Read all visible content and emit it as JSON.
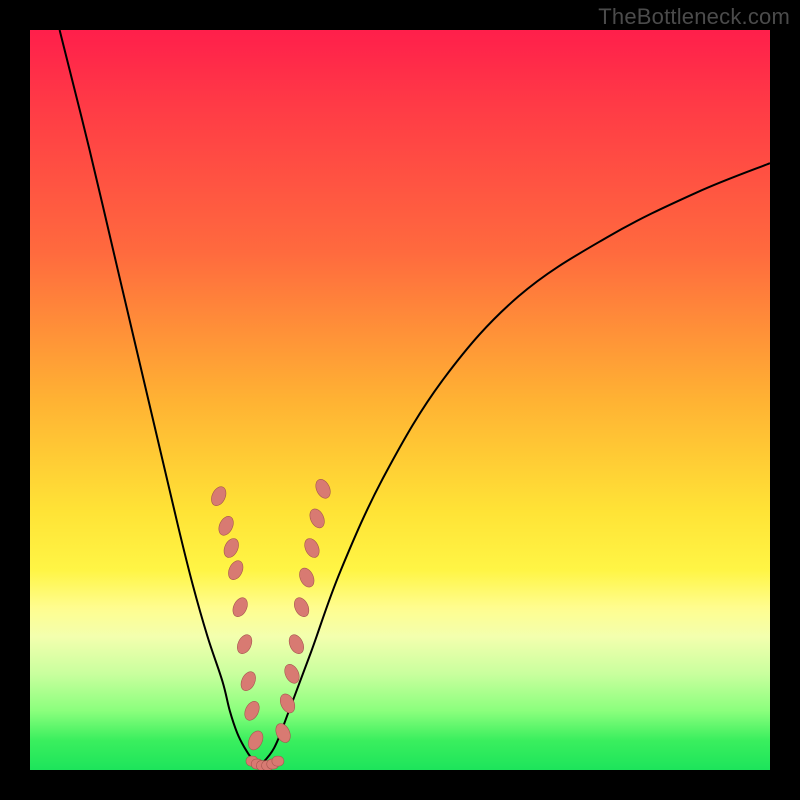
{
  "watermark": "TheBottleneck.com",
  "colors": {
    "frame": "#000000",
    "curve": "#000000",
    "marker_fill": "#d87a72",
    "marker_stroke": "#a5554e",
    "gradient_top": "#ff1f4b",
    "gradient_bottom": "#1de45b"
  },
  "chart_data": {
    "type": "line",
    "title": "",
    "xlabel": "",
    "ylabel": "",
    "xlim": [
      0,
      100
    ],
    "ylim": [
      0,
      100
    ],
    "series": [
      {
        "name": "left-curve",
        "x": [
          4,
          8,
          12,
          16,
          20,
          22,
          24,
          26,
          27,
          28,
          29,
          30,
          31
        ],
        "y": [
          100,
          84,
          67,
          50,
          33,
          25,
          18,
          12,
          8,
          5,
          3,
          1.5,
          0.5
        ]
      },
      {
        "name": "right-curve",
        "x": [
          31,
          33,
          35,
          38,
          42,
          48,
          56,
          66,
          78,
          90,
          100
        ],
        "y": [
          0.5,
          3,
          8,
          16,
          27,
          40,
          53,
          64,
          72,
          78,
          82
        ]
      },
      {
        "name": "markers-left",
        "x": [
          25.5,
          26.5,
          27.2,
          27.8,
          28.4,
          29.0,
          29.5,
          30.0,
          30.5
        ],
        "y": [
          37,
          33,
          30,
          27,
          22,
          17,
          12,
          8,
          4
        ]
      },
      {
        "name": "markers-bottom",
        "x": [
          30.0,
          30.7,
          31.4,
          32.1,
          32.8,
          33.5
        ],
        "y": [
          1.2,
          0.8,
          0.6,
          0.6,
          0.8,
          1.2
        ]
      },
      {
        "name": "markers-right",
        "x": [
          34.2,
          34.8,
          35.4,
          36.0,
          36.7,
          37.4,
          38.1,
          38.8,
          39.6
        ],
        "y": [
          5,
          9,
          13,
          17,
          22,
          26,
          30,
          34,
          38
        ]
      }
    ],
    "annotations": []
  }
}
